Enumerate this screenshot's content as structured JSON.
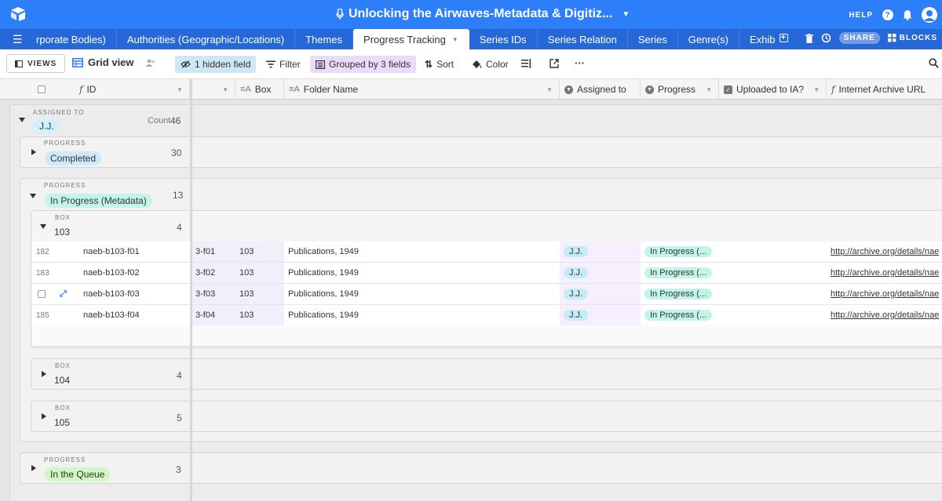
{
  "app": {
    "title": "Unlocking the Airwaves-Metadata & Digitiz...",
    "help": "HELP"
  },
  "tabs": [
    "rporate Bodies)",
    "Authorities (Geographic/Locations)",
    "Themes",
    "Progress Tracking",
    "Series IDs",
    "Series Relation",
    "Series",
    "Genre(s)",
    "Exhibits"
  ],
  "tab_tools": {
    "share": "SHARE",
    "blocks": "BLOCKS"
  },
  "toolbar": {
    "views": "VIEWS",
    "grid_view": "Grid view",
    "hidden": "1 hidden field",
    "filter": "Filter",
    "grouped": "Grouped by 3 fields",
    "sort": "Sort",
    "color": "Color",
    "more": "···"
  },
  "columns": {
    "id": "ID",
    "box": "Box",
    "folder": "Folder Name",
    "assigned": "Assigned to",
    "progress": "Progress",
    "uploaded": "Uploaded to IA?",
    "iaurl": "Internet Archive URL"
  },
  "groups": {
    "assigned": {
      "label": "ASSIGNED TO",
      "value": "J.J.",
      "count_label": "Count",
      "count": "46"
    },
    "completed": {
      "label": "PROGRESS",
      "value": "Completed",
      "count": "30"
    },
    "inprogress": {
      "label": "PROGRESS",
      "value": "In Progress (Metadata)",
      "count": "13"
    },
    "box103": {
      "label": "BOX",
      "value": "103",
      "count": "4"
    },
    "box104": {
      "label": "BOX",
      "value": "104",
      "count": "4"
    },
    "box105": {
      "label": "BOX",
      "value": "105",
      "count": "5"
    },
    "queue": {
      "label": "PROGRESS",
      "value": "In the Queue",
      "count": "3"
    }
  },
  "rows": [
    {
      "num": "182",
      "id": "naeb-b103-f01",
      "short": "3-f01",
      "box": "103",
      "folder": "Publications, 1949",
      "assigned": "J.J.",
      "progress": "In Progress (...",
      "url": "http://archive.org/details/nae"
    },
    {
      "num": "183",
      "id": "naeb-b103-f02",
      "short": "3-f02",
      "box": "103",
      "folder": "Publications, 1949",
      "assigned": "J.J.",
      "progress": "In Progress (...",
      "url": "http://archive.org/details/nae"
    },
    {
      "num": "",
      "id": "naeb-b103-f03",
      "short": "3-f03",
      "box": "103",
      "folder": "Publications, 1949",
      "assigned": "J.J.",
      "progress": "In Progress (...",
      "url": "http://archive.org/details/nae"
    },
    {
      "num": "185",
      "id": "naeb-b103-f04",
      "short": "3-f04",
      "box": "103",
      "folder": "Publications, 1949",
      "assigned": "J.J.",
      "progress": "In Progress (...",
      "url": "http://archive.org/details/nae"
    }
  ],
  "colors": {
    "topbar": "#2d7ff9",
    "tabbar": "#2768d9",
    "jj": "#d0f0fd",
    "completed": "#cfe9fb",
    "inprogress": "#c2f5e9",
    "queue": "#d1f7c4",
    "assigned_col": "#f6effd"
  }
}
